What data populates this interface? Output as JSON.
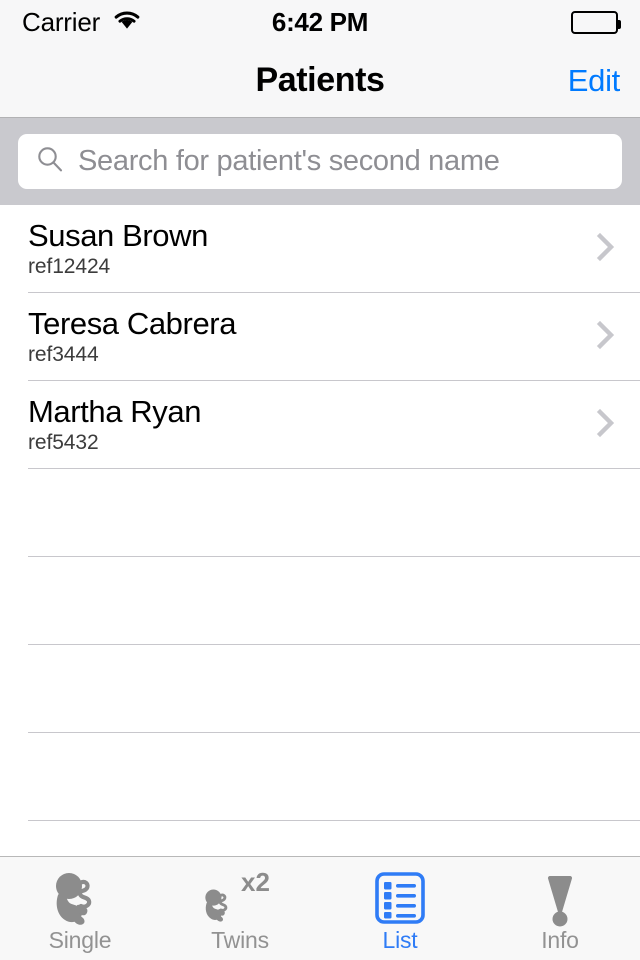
{
  "status_bar": {
    "carrier": "Carrier",
    "wifi_icon": "wifi-icon",
    "time": "6:42 PM",
    "battery_icon": "battery-full-icon"
  },
  "nav_bar": {
    "title": "Patients",
    "edit_label": "Edit"
  },
  "search": {
    "icon": "search-icon",
    "placeholder": "Search for patient's second name",
    "value": ""
  },
  "list": {
    "rows": [
      {
        "name": "Susan Brown",
        "ref": "ref12424",
        "accessory": "chevron-right-icon"
      },
      {
        "name": "Teresa Cabrera",
        "ref": "ref3444",
        "accessory": "chevron-right-icon"
      },
      {
        "name": "Martha Ryan",
        "ref": "ref5432",
        "accessory": "chevron-right-icon"
      }
    ],
    "empty_row_count": 5
  },
  "tab_bar": {
    "tabs": [
      {
        "label": "Single",
        "icon": "fetus-icon",
        "active": false
      },
      {
        "label": "Twins",
        "icon": "fetus-x2-icon",
        "active": false
      },
      {
        "label": "List",
        "icon": "list-bullet-icon",
        "active": true
      },
      {
        "label": "Info",
        "icon": "exclamation-icon",
        "active": false
      }
    ]
  },
  "colors": {
    "accent": "#007aff",
    "tab_active": "#2f7cf6",
    "tab_inactive": "#929292",
    "nav_background": "#f7f7f8",
    "search_background": "#c9c9ce",
    "separator": "#c8c7cc",
    "chevron": "#c7c7cc",
    "placeholder": "#8e8e93"
  }
}
